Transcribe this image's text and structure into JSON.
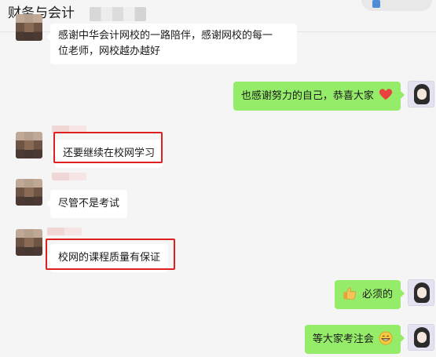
{
  "header": {
    "title": "财务与会计"
  },
  "messages": [
    {
      "side": "left",
      "lines": [
        "感谢中华会计网校的一路陪伴，感谢网校的每一",
        "位老师，网校越办越好"
      ]
    },
    {
      "side": "right",
      "text": "也感谢努力的自己，恭喜大家",
      "emoji": "red-heart"
    },
    {
      "side": "left",
      "text": "还要继续在校网学习",
      "highlighted": true
    },
    {
      "side": "left",
      "text": "尽管不是考试"
    },
    {
      "side": "left",
      "text": "校网的课程质量有保证",
      "highlighted": true
    },
    {
      "side": "right",
      "text": "必须的",
      "emoji": "thumbs-up"
    },
    {
      "side": "right",
      "text": "等大家考注会",
      "emoji": "grinning-face"
    }
  ],
  "colors": {
    "background": "#f5f5f5",
    "bubble_left": "#ffffff",
    "bubble_right": "#95ec69",
    "highlight": "#e02020"
  }
}
